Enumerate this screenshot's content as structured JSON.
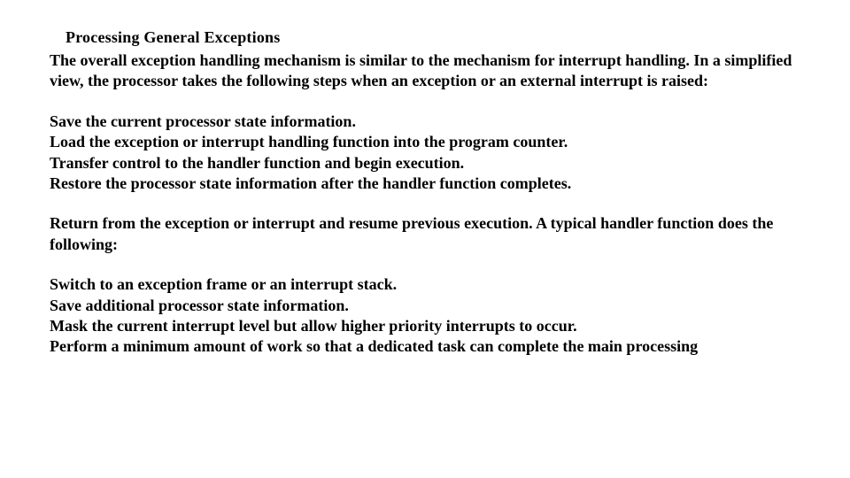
{
  "heading": "Processing General Exceptions",
  "intro": "The overall exception handling mechanism is similar to the mechanism for interrupt handling. In a simplified view, the processor takes the following steps when an exception or an external interrupt is raised:",
  "steps1": [
    "Save the current processor state information.",
    "Load the exception or interrupt handling function into the program counter.",
    "Transfer control to the handler function and begin execution.",
    "Restore the processor state information after the handler function completes."
  ],
  "mid": "Return from the exception or interrupt and resume previous execution. A typical handler function does the following:",
  "steps2": [
    "Switch to an exception frame or an interrupt stack.",
    "Save additional processor state information.",
    "Mask the current interrupt level but allow higher priority interrupts to occur.",
    "Perform a minimum amount of work so that a dedicated task can complete the main processing"
  ]
}
